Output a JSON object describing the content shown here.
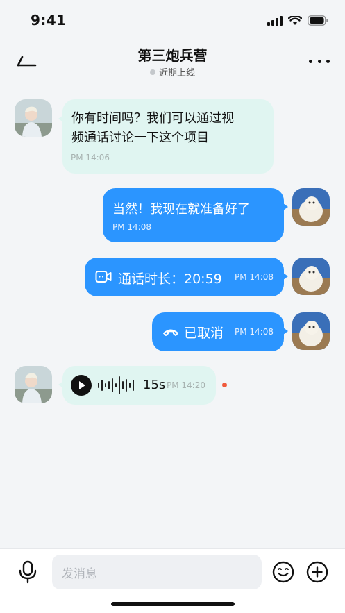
{
  "status_bar": {
    "time": "9:41"
  },
  "header": {
    "title": "第三炮兵营",
    "status": "近期上线"
  },
  "messages": [
    {
      "id": 1,
      "direction": "in",
      "type": "text",
      "text_line1": "你有时间吗？我们可以通过视",
      "text_line2": "频通话讨论一下这个项目",
      "time": "PM 14:06"
    },
    {
      "id": 2,
      "direction": "out",
      "type": "text",
      "text": "当然！我现在就准备好了",
      "time": "PM 14:08"
    },
    {
      "id": 3,
      "direction": "out",
      "type": "call",
      "text": "通话时长：20:59",
      "time": "PM 14:08",
      "icon": "video-call-icon"
    },
    {
      "id": 4,
      "direction": "out",
      "type": "call-cancelled",
      "text": "已取消",
      "time": "PM 14:08",
      "icon": "hang-up-icon"
    },
    {
      "id": 5,
      "direction": "in",
      "type": "voice",
      "duration": "15s",
      "time": "PM 14:20",
      "unread": true,
      "icon": "play-icon"
    }
  ],
  "input": {
    "placeholder": "发消息"
  },
  "colors": {
    "outgoing_bubble": "#2b95ff",
    "incoming_bubble": "#e0f5f1",
    "unread_dot": "#f05a3c",
    "background": "#f3f5f7"
  }
}
